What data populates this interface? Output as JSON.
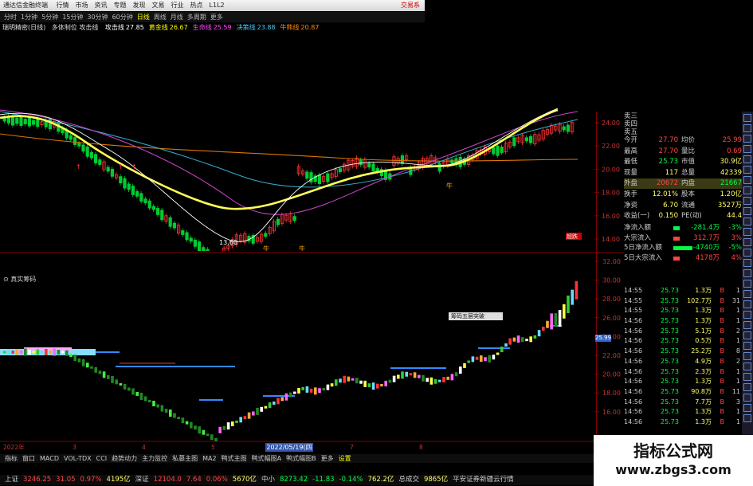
{
  "window": {
    "app_name": "通达信金融终端",
    "menu": [
      "行情",
      "市场",
      "资讯",
      "专题",
      "发现",
      "文易",
      "行业",
      "热点",
      "L1L2"
    ],
    "right_label": "交易系"
  },
  "period_tabs": {
    "items": [
      "分时",
      "1分钟",
      "5分钟",
      "15分钟",
      "30分钟",
      "60分钟",
      "日线",
      "周线",
      "月线",
      "多周期",
      "更多"
    ],
    "active": "日线"
  },
  "infoline": {
    "name": "瑞明精密(日线)",
    "formula": "多体制位 攻击线",
    "items": [
      {
        "label": "攻击线",
        "value": "27.85",
        "color": "#ffffff"
      },
      {
        "label": "黄金线",
        "value": "26.67",
        "color": "#ffff00"
      },
      {
        "label": "生命线",
        "value": "25.59",
        "color": "#ff44ff"
      },
      {
        "label": "决策线",
        "value": "23.88",
        "color": "#44ccff"
      },
      {
        "label": "牛熊线",
        "value": "20.87",
        "color": "#ff8800"
      }
    ]
  },
  "main_chart": {
    "y_ticks": [
      "24.00",
      "22.00",
      "20.00",
      "18.00",
      "16.00",
      "14.00"
    ],
    "low_label": "13.60",
    "signal_label": "牛",
    "indicator_label": "超跌"
  },
  "sub_chart": {
    "title": "真实筹码",
    "y_ticks": [
      "32.00",
      "30.00",
      "28.00",
      "26.00",
      "24.00",
      "22.00",
      "20.00",
      "18.00",
      "16.00"
    ],
    "price_tag": "25.99",
    "date_tag": "2022/05/19(四",
    "popup": "筹码五层突破",
    "x_ticks": [
      "2022年",
      "3",
      "4",
      "5",
      "6",
      "7",
      "8"
    ]
  },
  "quote": {
    "top_rows": [
      "卖三",
      "卖四",
      "卖五"
    ],
    "rows": [
      {
        "k": "今开",
        "v": "27.70",
        "vc": "#ff4444",
        "k2": "均价",
        "v2": "25.99",
        "v2c": "#ff4444"
      },
      {
        "k": "最高",
        "v": "27.70",
        "vc": "#ff4444",
        "k2": "量比",
        "v2": "0.69",
        "v2c": "#ff4444"
      },
      {
        "k": "最低",
        "v": "25.73",
        "vc": "#00ff44",
        "k2": "市值",
        "v2": "30.9亿",
        "v2c": "#ffff66"
      },
      {
        "k": "现量",
        "v": "117",
        "vc": "#ffff66",
        "k2": "总量",
        "v2": "42339",
        "v2c": "#ffff66"
      },
      {
        "k": "外盘",
        "v": "20672",
        "vc": "#ff4444",
        "k2": "内盘",
        "v2": "21667",
        "v2c": "#00ff44"
      },
      {
        "k": "换手",
        "v": "12.01%",
        "vc": "#ffff66",
        "k2": "股本",
        "v2": "1.20亿",
        "v2c": "#ffff66"
      },
      {
        "k": "净资",
        "v": "6.70",
        "vc": "#ffff66",
        "k2": "流通",
        "v2": "3527万",
        "v2c": "#ffff66"
      },
      {
        "k": "收益(一)",
        "v": "0.150",
        "vc": "#ffff66",
        "k2": "PE(动)",
        "v2": "44.4",
        "v2c": "#ffff66"
      }
    ],
    "flows": [
      {
        "k": "净流入额",
        "v": "-281.4万",
        "v2": "-3%",
        "c": "#00ff44"
      },
      {
        "k": "大宗流入",
        "v": "312.7万",
        "v2": "3%",
        "c": "#ff4444"
      },
      {
        "k": "5日净流入额",
        "v": "-4740万",
        "v2": "-5%",
        "c": "#00ff44"
      },
      {
        "k": "5日大宗流入",
        "v": "4178万",
        "v2": "4%",
        "c": "#ff4444"
      }
    ]
  },
  "trades": [
    {
      "t": "14:55",
      "p": "25.73",
      "v": "1.3万",
      "d": "B",
      "n": "1"
    },
    {
      "t": "14:55",
      "p": "25.73",
      "v": "102.7万",
      "d": "B",
      "n": "31"
    },
    {
      "t": "14:55",
      "p": "25.73",
      "v": "1.3万",
      "d": "B",
      "n": "1"
    },
    {
      "t": "14:56",
      "p": "25.73",
      "v": "1.3万",
      "d": "B",
      "n": "1"
    },
    {
      "t": "14:56",
      "p": "25.73",
      "v": "5.1万",
      "d": "B",
      "n": "2"
    },
    {
      "t": "14:56",
      "p": "25.73",
      "v": "0.5万",
      "d": "B",
      "n": "1"
    },
    {
      "t": "14:56",
      "p": "25.73",
      "v": "25.2万",
      "d": "B",
      "n": "8"
    },
    {
      "t": "14:56",
      "p": "25.73",
      "v": "4.9万",
      "d": "B",
      "n": "2"
    },
    {
      "t": "14:56",
      "p": "25.73",
      "v": "2.3万",
      "d": "B",
      "n": "1"
    },
    {
      "t": "14:56",
      "p": "25.73",
      "v": "1.3万",
      "d": "B",
      "n": "1"
    },
    {
      "t": "14:56",
      "p": "25.73",
      "v": "90.8万",
      "d": "B",
      "n": "11"
    },
    {
      "t": "14:56",
      "p": "25.73",
      "v": "7.7万",
      "d": "B",
      "n": "3"
    },
    {
      "t": "14:56",
      "p": "25.73",
      "v": "1.3万",
      "d": "B",
      "n": "1"
    },
    {
      "t": "14:56",
      "p": "25.73",
      "v": "1.3万",
      "d": "B",
      "n": "1"
    }
  ],
  "bottom_tabs": [
    "指标",
    "窗口",
    "MACD",
    "VOL-TDX",
    "CCI",
    "趋势动力",
    "主力监控",
    "私募主图",
    "MA2",
    "鸭式主图",
    "鸭式幅图A",
    "鸭式幅图B",
    "更多",
    "设置"
  ],
  "bottom_right": "模板",
  "ticker_bar": [
    {
      "text": "上证",
      "c": "#cccccc"
    },
    {
      "text": "3246.25",
      "c": "#ff4444"
    },
    {
      "text": "31.05",
      "c": "#ff4444"
    },
    {
      "text": "0.97%",
      "c": "#ff4444"
    },
    {
      "text": "4195亿",
      "c": "#ffff66"
    },
    {
      "text": "深证",
      "c": "#cccccc"
    },
    {
      "text": "12104.0",
      "c": "#ff4444"
    },
    {
      "text": "7.64",
      "c": "#ff4444"
    },
    {
      "text": "0.06%",
      "c": "#ff4444"
    },
    {
      "text": "5670亿",
      "c": "#ffff66"
    },
    {
      "text": "中小",
      "c": "#cccccc"
    },
    {
      "text": "8273.42",
      "c": "#00ff44"
    },
    {
      "text": "-11.83",
      "c": "#00ff44"
    },
    {
      "text": "-0.14%",
      "c": "#00ff44"
    },
    {
      "text": "762.2亿",
      "c": "#ffff66"
    },
    {
      "text": "总成交",
      "c": "#cccccc"
    },
    {
      "text": "9865亿",
      "c": "#ffff66"
    },
    {
      "text": "平安证券新疆云行情",
      "c": "#cccccc"
    }
  ],
  "watermark": {
    "line1": "指标公式网",
    "line2": "www.zbgs3.com"
  }
}
